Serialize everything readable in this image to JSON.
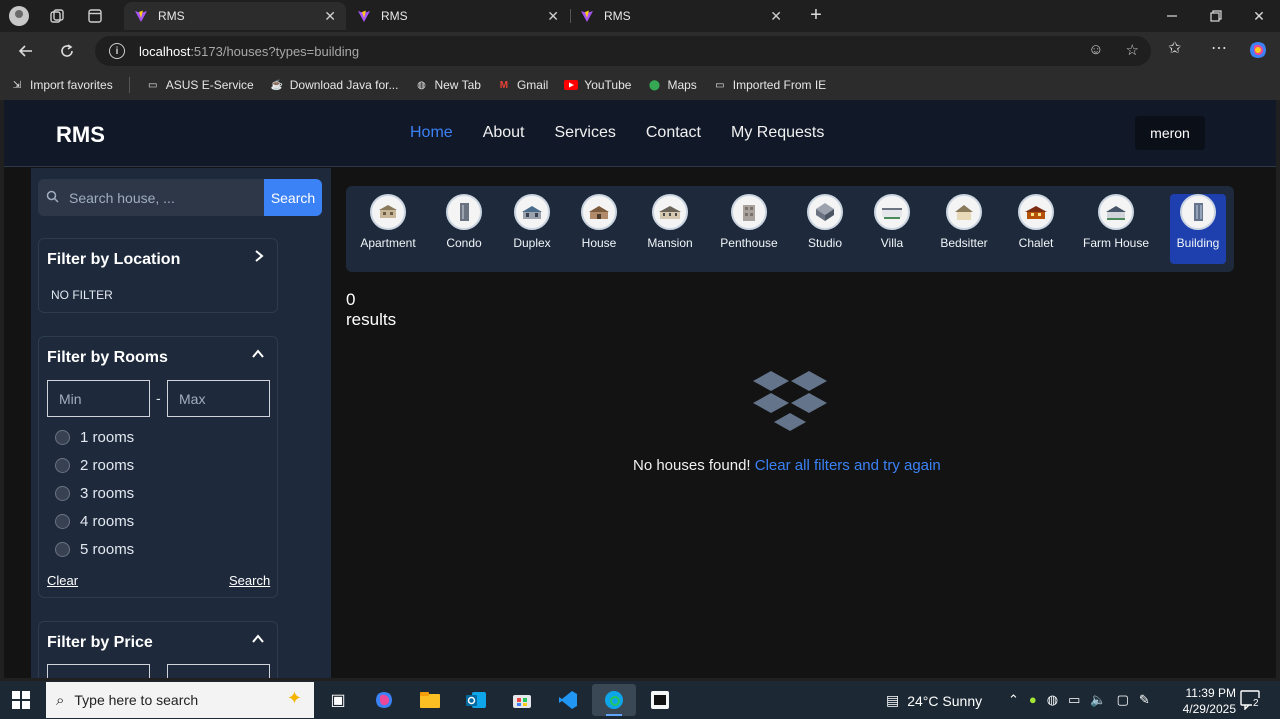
{
  "browser": {
    "tabs": [
      {
        "title": "RMS",
        "active": true
      },
      {
        "title": "RMS",
        "active": false
      },
      {
        "title": "RMS",
        "active": false
      }
    ],
    "url_host": "localhost",
    "url_rest": ":5173/houses?types=building",
    "bookmarks": [
      {
        "label": "Import favorites",
        "icon": "import-icon"
      },
      {
        "label": "ASUS E-Service",
        "icon": "folder-icon"
      },
      {
        "label": "Download Java for...",
        "icon": "java-icon"
      },
      {
        "label": "New Tab",
        "icon": "globe-icon"
      },
      {
        "label": "Gmail",
        "icon": "gmail-icon"
      },
      {
        "label": "YouTube",
        "icon": "youtube-icon"
      },
      {
        "label": "Maps",
        "icon": "maps-icon"
      },
      {
        "label": "Imported From IE",
        "icon": "folder-icon"
      }
    ]
  },
  "navbar": {
    "brand": "RMS",
    "links": [
      {
        "label": "Home",
        "active": true
      },
      {
        "label": "About",
        "active": false
      },
      {
        "label": "Services",
        "active": false
      },
      {
        "label": "Contact",
        "active": false
      },
      {
        "label": "My Requests",
        "active": false
      }
    ],
    "user": "meron"
  },
  "sidebar": {
    "search_placeholder": "Search house, ...",
    "search_button": "Search",
    "location": {
      "title": "Filter by Location",
      "value": "NO FILTER"
    },
    "rooms": {
      "title": "Filter by Rooms",
      "min_placeholder": "Min",
      "max_placeholder": "Max",
      "separator": "-",
      "options": [
        "1 rooms",
        "2 rooms",
        "3 rooms",
        "4 rooms",
        "5 rooms"
      ],
      "clear": "Clear",
      "search": "Search"
    },
    "price": {
      "title": "Filter by Price"
    }
  },
  "types": [
    {
      "label": "Apartment",
      "selected": false
    },
    {
      "label": "Condo",
      "selected": false
    },
    {
      "label": "Duplex",
      "selected": false
    },
    {
      "label": "House",
      "selected": false
    },
    {
      "label": "Mansion",
      "selected": false
    },
    {
      "label": "Penthouse",
      "selected": false
    },
    {
      "label": "Studio",
      "selected": false
    },
    {
      "label": "Villa",
      "selected": false
    },
    {
      "label": "Bedsitter",
      "selected": false
    },
    {
      "label": "Chalet",
      "selected": false
    },
    {
      "label": "Farm House",
      "selected": false
    },
    {
      "label": "Building",
      "selected": true
    }
  ],
  "results": {
    "count_text": "0 results",
    "empty_text": "No houses found!",
    "clear_link": "Clear all filters and try again"
  },
  "taskbar": {
    "search_placeholder": "Type here to search",
    "weather": "24°C  Sunny",
    "time": "11:39 PM",
    "date": "4/29/2025",
    "notifications": "2"
  },
  "colors": {
    "accent": "#3b82f6",
    "navbar": "#111827",
    "sidebar": "#1e2a3b"
  }
}
